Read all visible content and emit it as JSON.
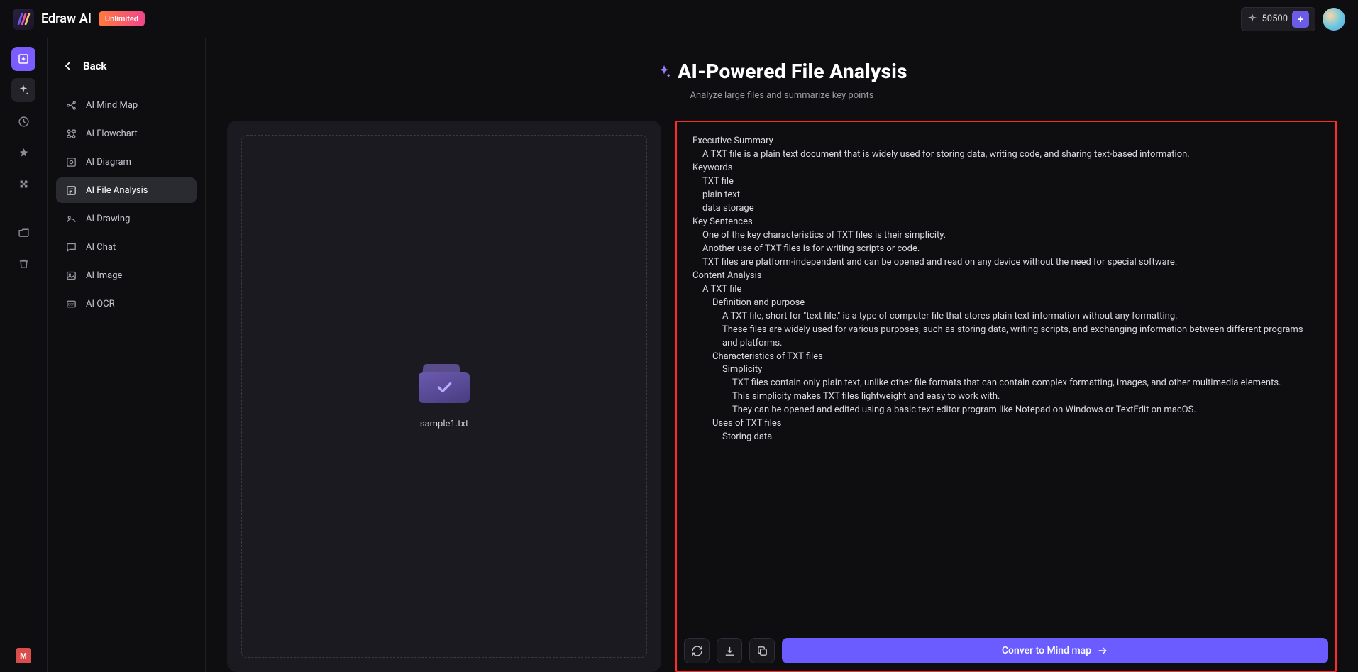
{
  "brand": "Edraw AI",
  "badge": "Unlimited",
  "credits": "50500",
  "sidebar": {
    "back": "Back",
    "items": [
      {
        "label": "AI Mind Map"
      },
      {
        "label": "AI Flowchart"
      },
      {
        "label": "AI Diagram"
      },
      {
        "label": "AI File Analysis"
      },
      {
        "label": "AI Drawing"
      },
      {
        "label": "AI Chat"
      },
      {
        "label": "AI Image"
      },
      {
        "label": "AI OCR"
      }
    ]
  },
  "main": {
    "title": "AI-Powered File Analysis",
    "subtitle": "Analyze large files and summarize key points",
    "uploaded_file": "sample1.txt",
    "convert_label": "Conver to Mind map"
  },
  "analysis": {
    "exec_h": "Executive Summary",
    "exec_1": "A TXT file is a plain text document that is widely used for storing data, writing code, and sharing text-based information.",
    "kw_h": "Keywords",
    "kw_1": "TXT file",
    "kw_2": "plain text",
    "kw_3": "data storage",
    "ks_h": "Key Sentences",
    "ks_1": "One of the key characteristics of TXT files is their simplicity.",
    "ks_2": "Another use of TXT files is for writing scripts or code.",
    "ks_3": "TXT files are platform-independent and can be opened and read on any device without the need for special software.",
    "ca_h": "Content Analysis",
    "ca_1": "A TXT file",
    "ca_dp": "Definition and purpose",
    "ca_dp_1": "A TXT file, short for \"text file,\" is a type of computer file that stores plain text information without any formatting.",
    "ca_dp_2": "These files are widely used for various purposes, such as storing data, writing scripts, and exchanging information between different programs and platforms.",
    "ca_ch": "Characteristics of TXT files",
    "ca_ch_s": "Simplicity",
    "ca_ch_s1": "TXT files contain only plain text, unlike other file formats that can contain complex formatting, images, and other multimedia elements.",
    "ca_ch_s2": "This simplicity makes TXT files lightweight and easy to work with.",
    "ca_ch_s3": "They can be opened and edited using a basic text editor program like Notepad on Windows or TextEdit on macOS.",
    "ca_us": "Uses of TXT files",
    "ca_us_sd": "Storing data"
  }
}
